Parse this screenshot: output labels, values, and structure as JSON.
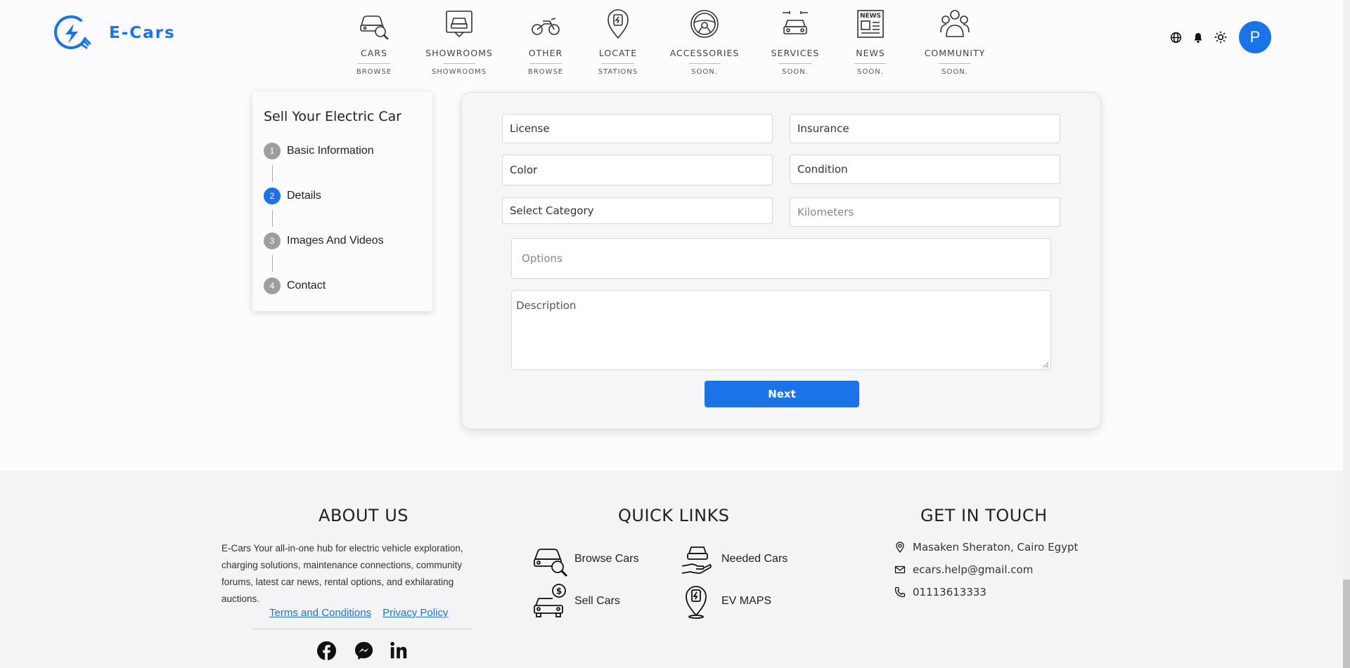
{
  "brand": {
    "name": "E-Cars",
    "color": "#1a73e8"
  },
  "nav": [
    {
      "label": "CARS",
      "sub": "BROWSE",
      "icon": "car-search-icon"
    },
    {
      "label": "SHOWROOMS",
      "sub": "SHOWROOMS",
      "icon": "showroom-icon"
    },
    {
      "label": "OTHER",
      "sub": "BROWSE",
      "icon": "motorcycle-icon"
    },
    {
      "label": "LOCATE",
      "sub": "STATIONS",
      "icon": "charging-station-pin-icon"
    },
    {
      "label": "ACCESSORIES",
      "sub": "SOON.",
      "icon": "steering-wheel-icon"
    },
    {
      "label": "SERVICES",
      "sub": "SOON.",
      "icon": "car-service-icon"
    },
    {
      "label": "NEWS",
      "sub": "SOON.",
      "icon": "newspaper-icon"
    },
    {
      "label": "COMMUNITY",
      "sub": "SOON.",
      "icon": "community-icon"
    }
  ],
  "header_tools": {
    "avatar_letter": "P"
  },
  "stepper": {
    "title": "Sell Your Electric Car",
    "steps": [
      {
        "num": "1",
        "label": "Basic Information"
      },
      {
        "num": "2",
        "label": "Details",
        "active": true
      },
      {
        "num": "3",
        "label": "Images And Videos"
      },
      {
        "num": "4",
        "label": "Contact"
      }
    ]
  },
  "form": {
    "license": "License",
    "insurance": "Insurance",
    "color": "Color",
    "condition": "Condition",
    "category": "Select Category",
    "kilometers": "Kilometers",
    "options": "Options",
    "description": "Description",
    "next": "Next"
  },
  "footer": {
    "about": {
      "title": "ABOUT US",
      "text": "E-Cars Your all-in-one hub for electric vehicle exploration, charging solutions, maintenance connections, community forums, latest car news, rental options, and exhilarating auctions.",
      "terms": "Terms and Conditions",
      "privacy": "Privacy Policy"
    },
    "quick_links": {
      "title": "QUICK LINKS",
      "items": [
        {
          "label": "Browse Cars",
          "icon": "car-search-icon"
        },
        {
          "label": "Needed Cars",
          "icon": "hand-car-icon"
        },
        {
          "label": "Sell Cars",
          "icon": "car-dollar-icon"
        },
        {
          "label": "EV MAPS",
          "icon": "ev-map-pin-icon"
        }
      ]
    },
    "contact": {
      "title": "GET IN TOUCH",
      "address": "Masaken Sheraton, Cairo Egypt",
      "email": "ecars.help@gmail.com",
      "phone": "01113613333"
    }
  }
}
